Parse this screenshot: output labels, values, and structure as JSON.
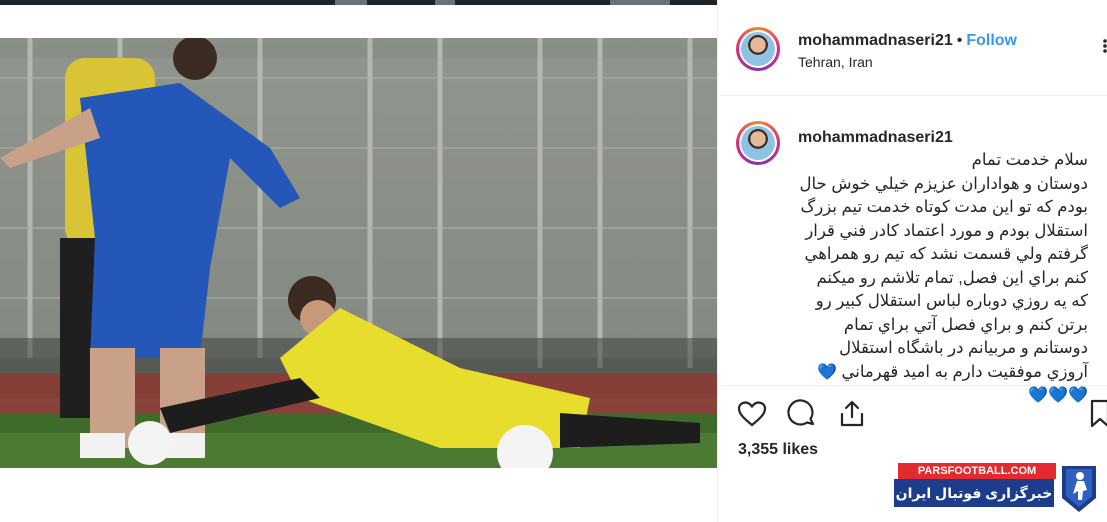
{
  "post": {
    "username": "mohammadnaseri21",
    "separator": "•",
    "follow_label": "Follow",
    "location": "Tehran, Iran"
  },
  "caption": {
    "username": "mohammadnaseri21",
    "lines": [
      "سلام خدمت تمام",
      "دوستان و هواداران عزيزم خيلي خوش حال",
      "بودم كه تو اين مدت كوتاه خدمت تيم بزرگ",
      "استقلال بودم و مورد اعتماد كادر فني قرار",
      "گرفتم ولي قسمت نشد كه تيم رو همراهي",
      "كنم براي اين فصل, تمام تلاشم رو ميكنم",
      "كه يه روزي دوباره لباس استقلال كبير رو",
      "برتن كنم و براي فصل آتي براي تمام",
      "دوستانم و مربيانم در باشگاه استقلال",
      "آروزي موفقيت دارم به اميد قهرماني"
    ],
    "inline_emoji": "💙",
    "emoji_line": "💙💙💙"
  },
  "stats": {
    "likes": "3,355 likes"
  },
  "watermark": {
    "site": "PARSFOOTBALL.COM",
    "tagline": "خبرگزاری فوتبال ایران"
  },
  "icons": [
    "more-options-icon",
    "like-heart-icon",
    "comment-icon",
    "share-icon",
    "save-bookmark-icon"
  ],
  "colors": {
    "follow": "#3897f0",
    "border": "#efefef",
    "text": "#262626",
    "watermark_red": "#e32b2f",
    "watermark_blue": "#1d3c8c"
  }
}
